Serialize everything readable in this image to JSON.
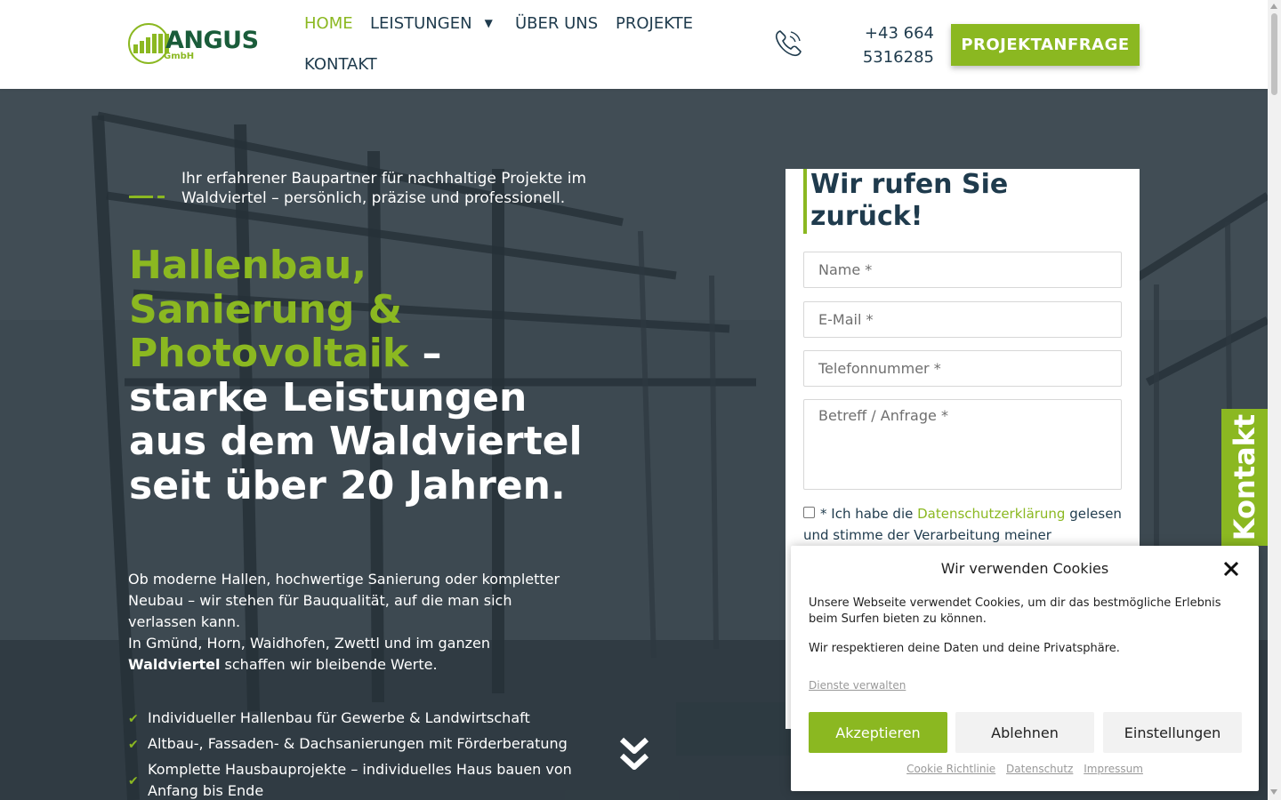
{
  "brand": {
    "logo_name": "ANGUS",
    "logo_suffix": "GmbH",
    "accent_color": "#8bb821",
    "text_color": "#1f3b4d"
  },
  "nav": {
    "items": [
      {
        "label": "HOME",
        "active": true
      },
      {
        "label": "LEISTUNGEN",
        "has_dropdown": true
      },
      {
        "label": "ÜBER UNS"
      },
      {
        "label": "PROJEKTE"
      },
      {
        "label": "KONTAKT"
      }
    ],
    "phone_icon": "phone-icon",
    "phone_line1": "+43 664",
    "phone_line2": "5316285",
    "cta_label": "PROJEKTANFRAGE"
  },
  "hero": {
    "tagline": "Ihr erfahrener Baupartner für nachhaltige Projekte im Waldviertel – persönlich, präzise und professionell.",
    "headline_green": "Hallenbau, Sanierung & Photovoltaik",
    "headline_white_dash": " –",
    "headline_white": "starke Leistungen aus dem Waldviertel seit über 20 Jahren.",
    "intro_p1": "Ob moderne Hallen, hochwertige Sanierung oder kompletter Neubau – wir stehen für Bauqualität, auf die man sich verlassen kann.",
    "intro_p2_pre": "In Gmünd, Horn, Waidhofen, Zwettl und im ganzen ",
    "intro_p2_bold": "Waldviertel",
    "intro_p2_post": " schaffen wir bleibende Werte.",
    "features": [
      "Individueller Hallenbau für Gewerbe & Landwirtschaft",
      "Altbau-, Fassaden- & Dachsanierungen mit Förderberatung",
      "Komplette Hausbauprojekte – individuelles Haus bauen von Anfang bis Ende"
    ],
    "check_icon": "check-icon",
    "scroll_icon": "double-chevron-down-icon"
  },
  "form": {
    "title": "Wir rufen Sie zurück!",
    "name_placeholder": "Name *",
    "email_placeholder": "E-Mail *",
    "phone_placeholder": "Telefonnummer *",
    "message_placeholder": "Betreff / Anfrage *",
    "privacy_pre": "* Ich habe die ",
    "privacy_link": "Datenschutzerklärung",
    "privacy_post": " gelesen und stimme der Verarbeitung meiner"
  },
  "side_tab": {
    "label": "Kontakt"
  },
  "cookie": {
    "title": "Wir verwenden Cookies",
    "text1": "Unsere Webseite verwendet Cookies, um dir das bestmögliche Erlebnis beim Surfen bieten zu können.",
    "text2": "Wir respektieren deine Daten und deine Privatsphäre.",
    "manage_link": "Dienste verwalten",
    "accept_label": "Akzeptieren",
    "deny_label": "Ablehnen",
    "settings_label": "Einstellungen",
    "links": [
      "Cookie Richtlinie",
      "Datenschutz",
      "Impressum"
    ]
  }
}
